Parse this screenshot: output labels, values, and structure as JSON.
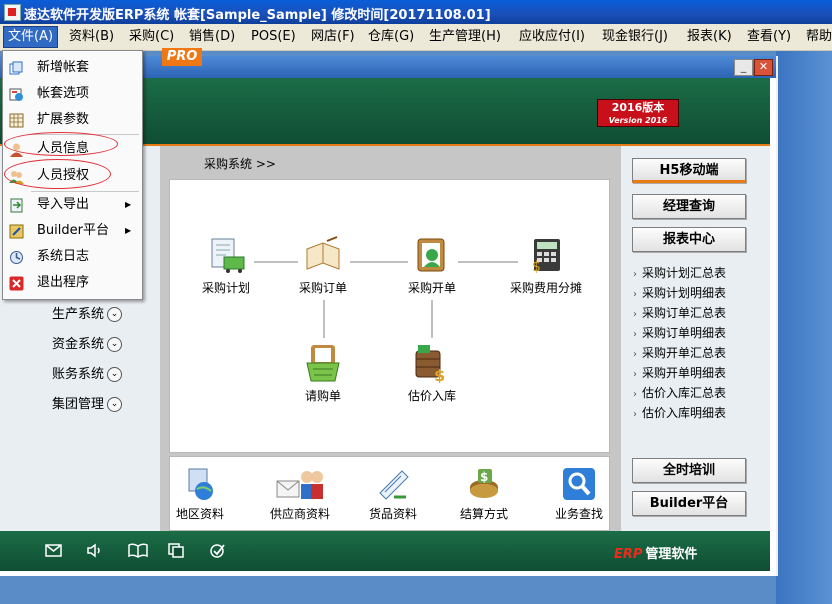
{
  "window": {
    "title": "速达软件开发版ERP系统  帐套[Sample_Sample] 修改时间[20171108.01]"
  },
  "menubar": [
    {
      "label": "文件(A)",
      "active": true
    },
    {
      "label": "资料(B)"
    },
    {
      "label": "采购(C)"
    },
    {
      "label": "销售(D)"
    },
    {
      "label": "POS(E)"
    },
    {
      "label": "网店(F)"
    },
    {
      "label": "仓库(G)"
    },
    {
      "label": "生产管理(H)"
    },
    {
      "label": "应收应付(I)"
    },
    {
      "label": "现金银行(J)"
    },
    {
      "label": "报表(K)"
    },
    {
      "label": "查看(Y)"
    },
    {
      "label": "帮助"
    }
  ],
  "file_menu": [
    {
      "label": "新增帐套",
      "icon": "new-book-icon"
    },
    {
      "label": "帐套选项",
      "icon": "book-options-icon"
    },
    {
      "label": "扩展参数",
      "icon": "extend-params-icon"
    },
    {
      "label": "人员信息",
      "icon": "user-info-icon",
      "highlighted": true
    },
    {
      "label": "人员授权",
      "icon": "user-auth-icon",
      "highlighted": true
    },
    {
      "label": "导入导出",
      "icon": "import-export-icon",
      "submenu": true
    },
    {
      "label": "Builder平台",
      "icon": "builder-icon",
      "submenu": true
    },
    {
      "label": "系统日志",
      "icon": "system-log-icon"
    },
    {
      "label": "退出程序",
      "icon": "exit-icon"
    }
  ],
  "banner": {
    "pro": "PRO",
    "version_label": "2016版本",
    "version_sub": "Version 2016"
  },
  "left_nav": [
    {
      "label": "生产系统"
    },
    {
      "label": "资金系统"
    },
    {
      "label": "账务系统"
    },
    {
      "label": "集团管理"
    }
  ],
  "breadcrumb": "采购系统  >>",
  "flow_nodes": [
    {
      "label": "采购计划",
      "icon": "purchase-plan-icon"
    },
    {
      "label": "采购订单",
      "icon": "purchase-order-icon"
    },
    {
      "label": "采购开单",
      "icon": "purchase-invoice-icon"
    },
    {
      "label": "采购费用分摊",
      "icon": "cost-allocation-icon"
    },
    {
      "label": "请购单",
      "icon": "requisition-icon"
    },
    {
      "label": "估价入库",
      "icon": "estimated-stock-in-icon"
    }
  ],
  "quick_access": [
    {
      "label": "地区资料",
      "icon": "region-icon"
    },
    {
      "label": "供应商资料",
      "icon": "supplier-icon"
    },
    {
      "label": "货品资料",
      "icon": "goods-icon"
    },
    {
      "label": "结算方式",
      "icon": "settlement-icon"
    },
    {
      "label": "业务查找",
      "icon": "business-search-icon"
    }
  ],
  "right_panel": {
    "mobile_button": "H5移动端",
    "manager_button": "经理查询",
    "report_button": "报表中心",
    "reports": [
      "采购计划汇总表",
      "采购计划明细表",
      "采购订单汇总表",
      "采购订单明细表",
      "采购开单汇总表",
      "采购开单明细表",
      "估价入库汇总表",
      "估价入库明细表"
    ],
    "training_button": "全时培训",
    "builder_button": "Builder平台"
  },
  "footer": {
    "brand_red": "ERP",
    "brand_text": "管理软件",
    "icons": [
      "mail-icon",
      "speaker-icon",
      "book-icon",
      "copy-icon",
      "check-icon"
    ]
  },
  "colors": {
    "banner_green": "#1b6d47",
    "accent_orange": "#e87b14",
    "titlebar_blue": "#1a4fb8",
    "highlight_red": "#e0303a"
  }
}
